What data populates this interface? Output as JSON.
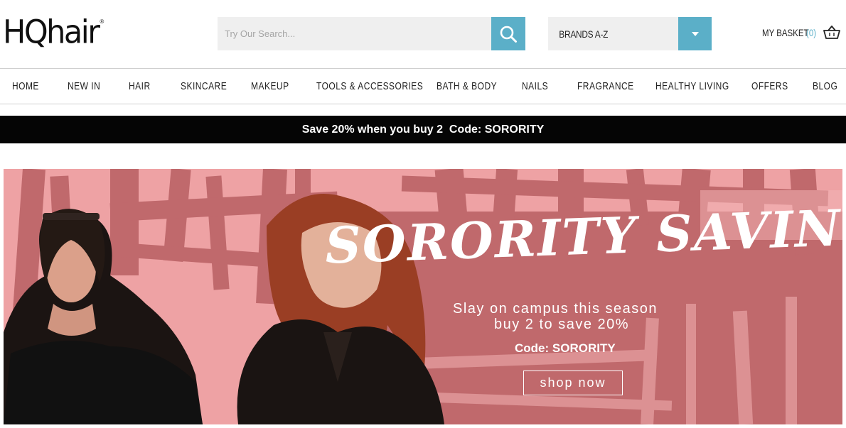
{
  "header": {
    "logo_text": "HQhair",
    "logo_mark": "®",
    "search": {
      "placeholder": "Try Our Search...",
      "icon": "search-icon"
    },
    "brands": {
      "label": "BRANDS A-Z",
      "icon": "chevron-down-icon"
    },
    "basket": {
      "label": "MY BASKET",
      "count": "(0)",
      "icon": "basket-icon"
    }
  },
  "nav": {
    "items": [
      "HOME",
      "NEW IN",
      "HAIR",
      "SKINCARE",
      "MAKEUP",
      "TOOLS & ACCESSORIES",
      "BATH & BODY",
      "NAILS",
      "FRAGRANCE",
      "HEALTHY LIVING",
      "OFFERS",
      "BLOG"
    ]
  },
  "promo": {
    "text": "Save 20% when you buy 2  Code: SORORITY"
  },
  "banner": {
    "headline": "SORORITY SAVINGS",
    "line1": "Slay on campus this season",
    "line2": "buy 2 to save 20%",
    "code": "Code: SORORITY",
    "button": "shop now"
  },
  "colors": {
    "accent": "#5bafc8",
    "promo_bg": "#050505",
    "banner_bg": "#eea2a4",
    "banner_stroke": "#b85f63"
  }
}
